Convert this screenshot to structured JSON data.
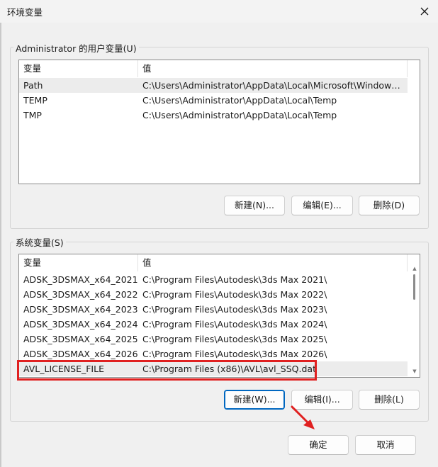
{
  "window": {
    "title": "环境变量",
    "close_icon": "close-icon"
  },
  "user_vars": {
    "label": "Administrator 的用户变量(U)",
    "columns": [
      "变量",
      "值"
    ],
    "rows": [
      {
        "name": "Path",
        "value": "C:\\Users\\Administrator\\AppData\\Local\\Microsoft\\WindowsA..."
      },
      {
        "name": "TEMP",
        "value": "C:\\Users\\Administrator\\AppData\\Local\\Temp"
      },
      {
        "name": "TMP",
        "value": "C:\\Users\\Administrator\\AppData\\Local\\Temp"
      }
    ],
    "buttons": {
      "new": "新建(N)...",
      "edit": "编辑(E)...",
      "delete": "删除(D)"
    }
  },
  "system_vars": {
    "label": "系统变量(S)",
    "columns": [
      "变量",
      "值"
    ],
    "rows": [
      {
        "name": "ADSK_3DSMAX_x64_2021",
        "value": "C:\\Program Files\\Autodesk\\3ds Max 2021\\"
      },
      {
        "name": "ADSK_3DSMAX_x64_2022",
        "value": "C:\\Program Files\\Autodesk\\3ds Max 2022\\"
      },
      {
        "name": "ADSK_3DSMAX_x64_2023",
        "value": "C:\\Program Files\\Autodesk\\3ds Max 2023\\"
      },
      {
        "name": "ADSK_3DSMAX_x64_2024",
        "value": "C:\\Program Files\\Autodesk\\3ds Max 2024\\"
      },
      {
        "name": "ADSK_3DSMAX_x64_2025",
        "value": "C:\\Program Files\\Autodesk\\3ds Max 2025\\"
      },
      {
        "name": "ADSK_3DSMAX_x64_2026",
        "value": "C:\\Program Files\\Autodesk\\3ds Max 2026\\"
      },
      {
        "name": "AVL_LICENSE_FILE",
        "value": "C:\\Program Files (x86)\\AVL\\avl_SSQ.dat"
      }
    ],
    "selected_row": "AVL_LICENSE_FILE",
    "buttons": {
      "new": "新建(W)...",
      "edit": "编辑(I)...",
      "delete": "删除(L)"
    }
  },
  "footer": {
    "ok": "确定",
    "cancel": "取消"
  },
  "annotations": {
    "highlight_color": "#e02020"
  }
}
